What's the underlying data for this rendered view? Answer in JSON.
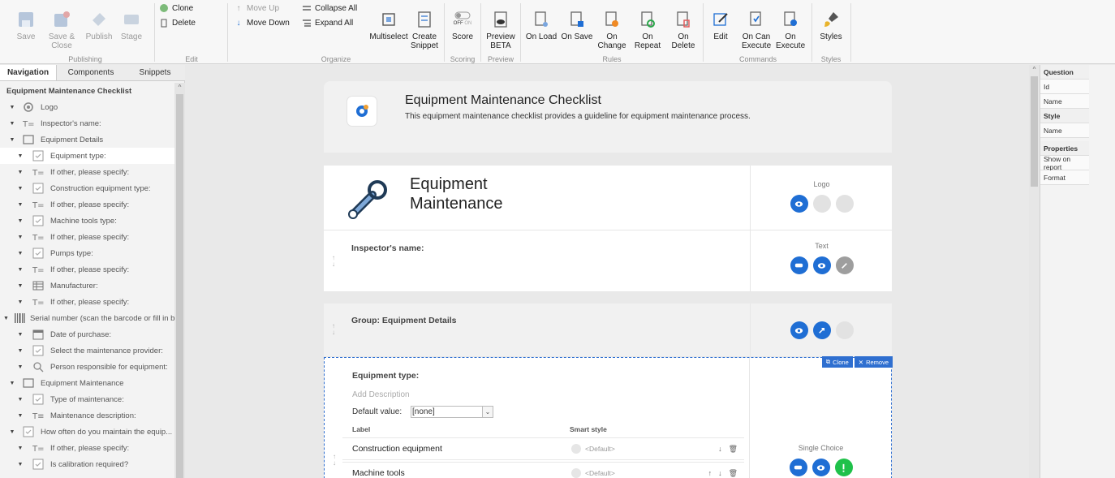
{
  "ribbon": {
    "save": "Save",
    "save_close": "Save & Close",
    "publish": "Publish",
    "stage": "Stage",
    "clone": "Clone",
    "delete": "Delete",
    "move_up": "Move Up",
    "move_down": "Move Down",
    "collapse_all": "Collapse All",
    "expand_all": "Expand All",
    "multiselect": "Multiselect",
    "create_snippet": "Create Snippet",
    "score_toggle_off": "OFF",
    "score_toggle_on": "ON",
    "score": "Score",
    "preview": "Preview",
    "preview_beta": "BETA",
    "on_load": "On Load",
    "on_save": "On Save",
    "on_change": "On Change",
    "on_repeat": "On Repeat",
    "on_delete": "On Delete",
    "edit": "Edit",
    "on_can_execute": "On Can Execute",
    "on_execute": "On Execute",
    "styles": "Styles",
    "groups": {
      "publishing": "Publishing",
      "edit": "Edit",
      "organize": "Organize",
      "scoring": "Scoring",
      "preview": "Preview",
      "rules": "Rules",
      "commands": "Commands",
      "styles": "Styles"
    },
    "colors": {
      "accent": "#1f6ed4",
      "disabled": "#9a9a9a"
    }
  },
  "left_panel": {
    "tabs": [
      "Navigation",
      "Components",
      "Snippets"
    ],
    "tree_title": "Equipment Maintenance Checklist",
    "items": [
      {
        "label": "Logo",
        "icon": "gear-icon",
        "indent": 1
      },
      {
        "label": "Inspector's name:",
        "icon": "text-icon",
        "indent": 1
      },
      {
        "label": "Equipment Details",
        "icon": "folder-icon",
        "indent": 1
      },
      {
        "label": "Equipment type:",
        "icon": "checkbox-icon",
        "indent": 2
      },
      {
        "label": "If other, please specify:",
        "icon": "text-icon",
        "indent": 2
      },
      {
        "label": "Construction equipment type:",
        "icon": "checkbox-icon",
        "indent": 2
      },
      {
        "label": "If other, please specify:",
        "icon": "text-icon",
        "indent": 2
      },
      {
        "label": "Machine tools type:",
        "icon": "checkbox-icon",
        "indent": 2
      },
      {
        "label": "If other, please specify:",
        "icon": "text-icon",
        "indent": 2
      },
      {
        "label": "Pumps type:",
        "icon": "checkbox-icon",
        "indent": 2
      },
      {
        "label": "If other, please specify:",
        "icon": "text-icon",
        "indent": 2
      },
      {
        "label": "Manufacturer:",
        "icon": "table-icon",
        "indent": 2
      },
      {
        "label": "If other, please specify:",
        "icon": "text-icon",
        "indent": 2
      },
      {
        "label": "Serial number (scan the barcode or fill in by",
        "icon": "barcode-icon",
        "indent": 0
      },
      {
        "label": "Date of purchase:",
        "icon": "calendar-icon",
        "indent": 2
      },
      {
        "label": "Select the maintenance provider:",
        "icon": "checkbox-icon",
        "indent": 2
      },
      {
        "label": "Person responsible for equipment:",
        "icon": "search-icon",
        "indent": 2
      },
      {
        "label": "Equipment Maintenance",
        "icon": "folder-icon",
        "indent": 1
      },
      {
        "label": "Type of maintenance:",
        "icon": "checkbox-icon",
        "indent": 2
      },
      {
        "label": "Maintenance description:",
        "icon": "multiline-text-icon",
        "indent": 2
      },
      {
        "label": "How often do you maintain the equip...",
        "icon": "checkbox-icon",
        "indent": 1
      },
      {
        "label": "If other, please specify:",
        "icon": "text-icon",
        "indent": 2
      },
      {
        "label": "Is calibration required?",
        "icon": "checkbox-icon",
        "indent": 2
      }
    ]
  },
  "canvas": {
    "header_title": "Equipment Maintenance Checklist",
    "header_desc": "This equipment maintenance checklist provides a guideline for equipment maintenance process.",
    "logo_text_line1": "Equipment",
    "logo_text_line2": "Maintenance",
    "logo_side_label": "Logo",
    "inspector_title": "Inspector's name:",
    "inspector_side_label": "Text",
    "group_title": "Group: Equipment Details",
    "selected": {
      "clone": "Clone",
      "remove": "Remove",
      "title": "Equipment type:",
      "add_description": "Add Description",
      "default_value_label": "Default value:",
      "default_value": "[none]",
      "col_label": "Label",
      "col_smart_style": "Smart style",
      "side_label": "Single Choice",
      "choices": [
        {
          "label": "Construction equipment",
          "style": "<Default>"
        },
        {
          "label": "Machine tools",
          "style": "<Default>"
        }
      ]
    }
  },
  "right_panel": {
    "question": "Question",
    "id": "Id",
    "name1": "Name",
    "style": "Style",
    "name2": "Name",
    "properties": "Properties",
    "show_on_report": "Show on report",
    "format": "Format"
  }
}
